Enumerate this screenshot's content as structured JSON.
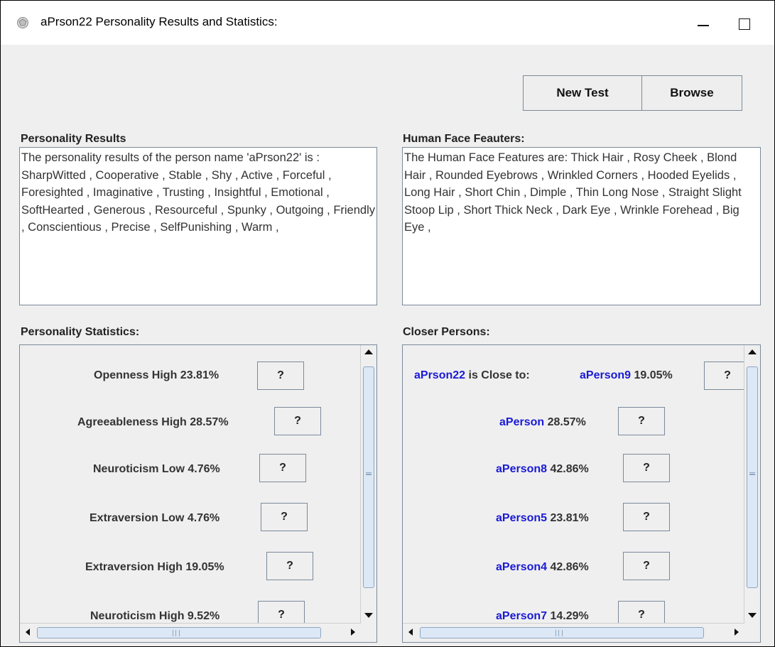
{
  "window": {
    "title": "aPrson22 Personality Results and Statistics:"
  },
  "toolbar": {
    "new_test_label": "New Test",
    "browse_label": "Browse"
  },
  "personality_results": {
    "label": "Personality Results",
    "text": "The personality results of the person name 'aPrson22' is : SharpWitted , Cooperative , Stable , Shy , Active , Forceful , Foresighted , Imaginative , Trusting , Insightful , Emotional , SoftHearted , Generous , Resourceful , Spunky , Outgoing , Friendly , Conscientious , Precise , SelfPunishing , Warm ,"
  },
  "face_features": {
    "label": "Human Face Feauters:",
    "text": "The Human Face Features  are:  Thick Hair ,  Rosy Cheek ,  Blond Hair ,  Rounded Eyebrows ,  Wrinkled Corners ,  Hooded Eyelids ,  Long Hair ,  Short Chin ,  Dimple ,  Thin Long Nose ,  Straight Slight Stoop Lip ,  Short Thick Neck ,  Dark Eye ,  Wrinkle Forehead ,  Big Eye ,"
  },
  "personality_statistics": {
    "label": "Personality Statistics:",
    "rows": [
      {
        "label": "Openness High  23.81%",
        "button": "?"
      },
      {
        "label": "Agreeableness High  28.57%",
        "button": "?"
      },
      {
        "label": "Neuroticism Low  4.76%",
        "button": "?"
      },
      {
        "label": "Extraversion Low  4.76%",
        "button": "?"
      },
      {
        "label": "Extraversion High  19.05%",
        "button": "?"
      },
      {
        "label": "Neuroticism High  9.52%",
        "button": "?"
      }
    ]
  },
  "closer_persons": {
    "label": "Closer Persons:",
    "header": {
      "subject": "aPrson22",
      "is_close_to": "is Close to:"
    },
    "rows": [
      {
        "name": "aPerson9",
        "percent": "19.05%",
        "button": "?"
      },
      {
        "name": "aPerson",
        "percent": "28.57%",
        "button": "?"
      },
      {
        "name": "aPerson8",
        "percent": "42.86%",
        "button": "?"
      },
      {
        "name": "aPerson5",
        "percent": "23.81%",
        "button": "?"
      },
      {
        "name": "aPerson4",
        "percent": "42.86%",
        "button": "?"
      },
      {
        "name": "aPerson7",
        "percent": "14.29%",
        "button": "?"
      }
    ]
  },
  "colors": {
    "person_name": "#1a1ad6",
    "panel_bg": "#efefef",
    "border": "#7a8a9a",
    "scroll_thumb": "#dce8f5"
  }
}
